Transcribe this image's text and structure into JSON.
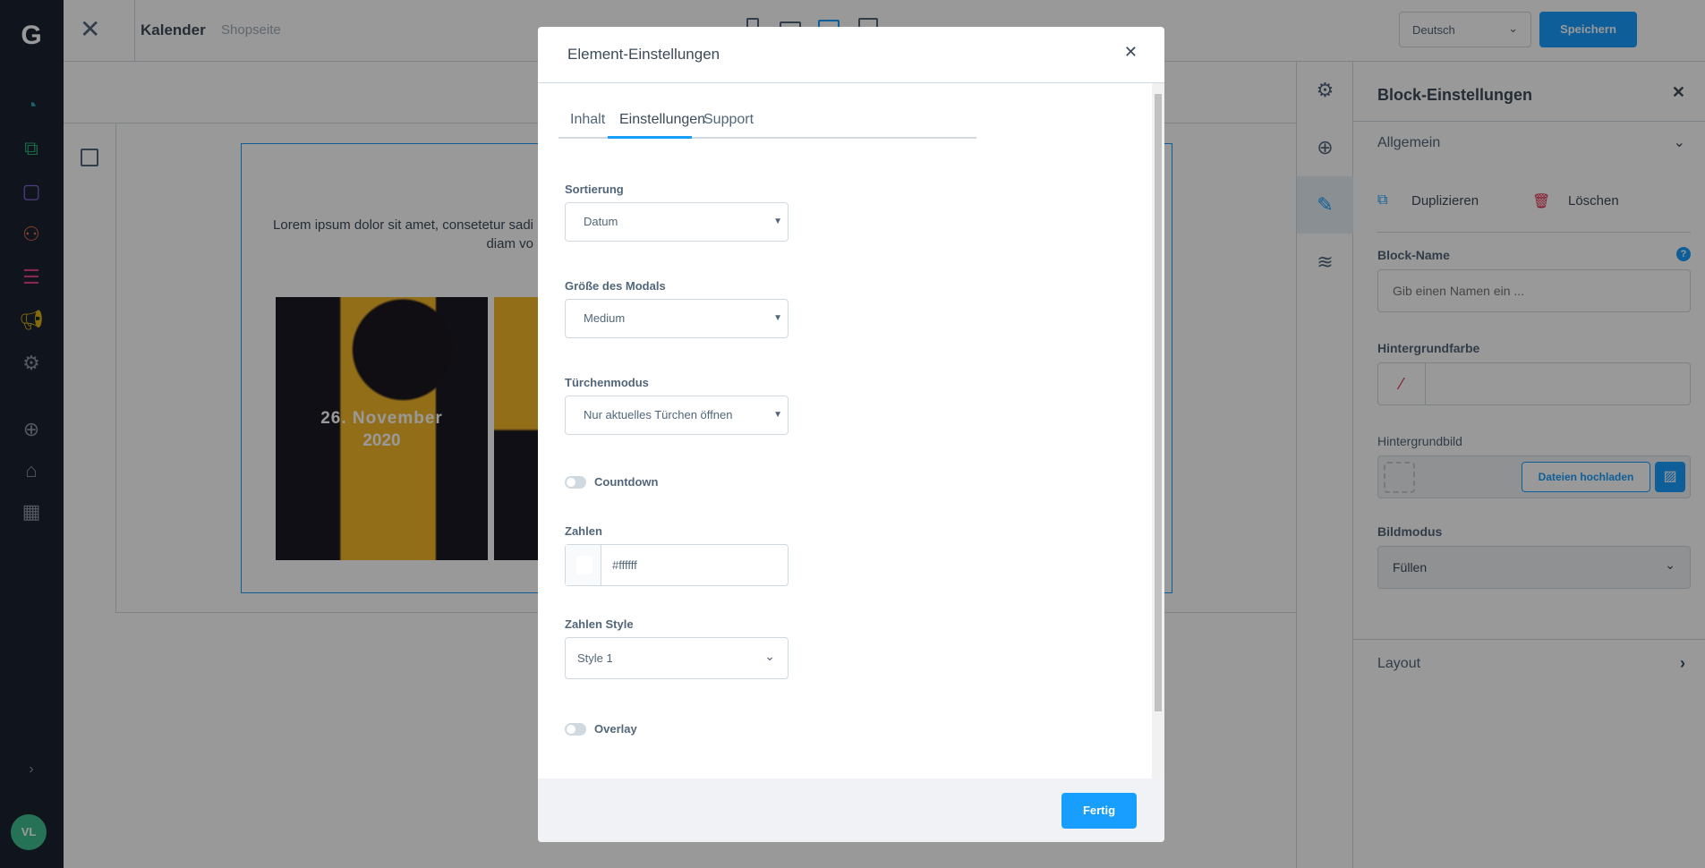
{
  "topbar": {
    "title": "Kalender",
    "subtitle": "Shopseite",
    "language": "Deutsch",
    "save_label": "Speichern"
  },
  "canvas": {
    "text_line1": "Lorem ipsum dolor sit amet, consetetur sadi",
    "text_line2": "diam vo",
    "tile_date": "26. November",
    "tile_year": "2020"
  },
  "panel": {
    "title": "Block-Einstellungen",
    "section_general": "Allgemein",
    "duplicate": "Duplizieren",
    "delete": "Löschen",
    "block_name_label": "Block-Name",
    "block_name_placeholder": "Gib einen Namen ein ...",
    "bg_color_label": "Hintergrundfarbe",
    "bg_image_label": "Hintergrundbild",
    "upload_label": "Dateien hochladen",
    "image_mode_label": "Bildmodus",
    "image_mode_value": "Füllen",
    "section_layout": "Layout"
  },
  "modal": {
    "title": "Element-Einstellungen",
    "tabs": [
      {
        "label": "Inhalt"
      },
      {
        "label": "Einstellungen",
        "active": true
      },
      {
        "label": "Support"
      }
    ],
    "sort_label": "Sortierung",
    "sort_value": "Datum",
    "size_label": "Größe des Modals",
    "size_value": "Medium",
    "door_label": "Türchenmodus",
    "door_value": "Nur aktuelles Türchen öffnen",
    "countdown_label": "Countdown",
    "countdown_on": false,
    "numbers_label": "Zahlen",
    "numbers_color": "#ffffff",
    "numbers_style_label": "Zahlen Style",
    "numbers_style_value": "Style 1",
    "overlay_label": "Overlay",
    "overlay_on": false,
    "done_label": "Fertig"
  },
  "user": {
    "initials": "VL"
  },
  "colors": {
    "accent": "#189eff",
    "save": "#0870ff",
    "sidebar": "#1b2230"
  }
}
